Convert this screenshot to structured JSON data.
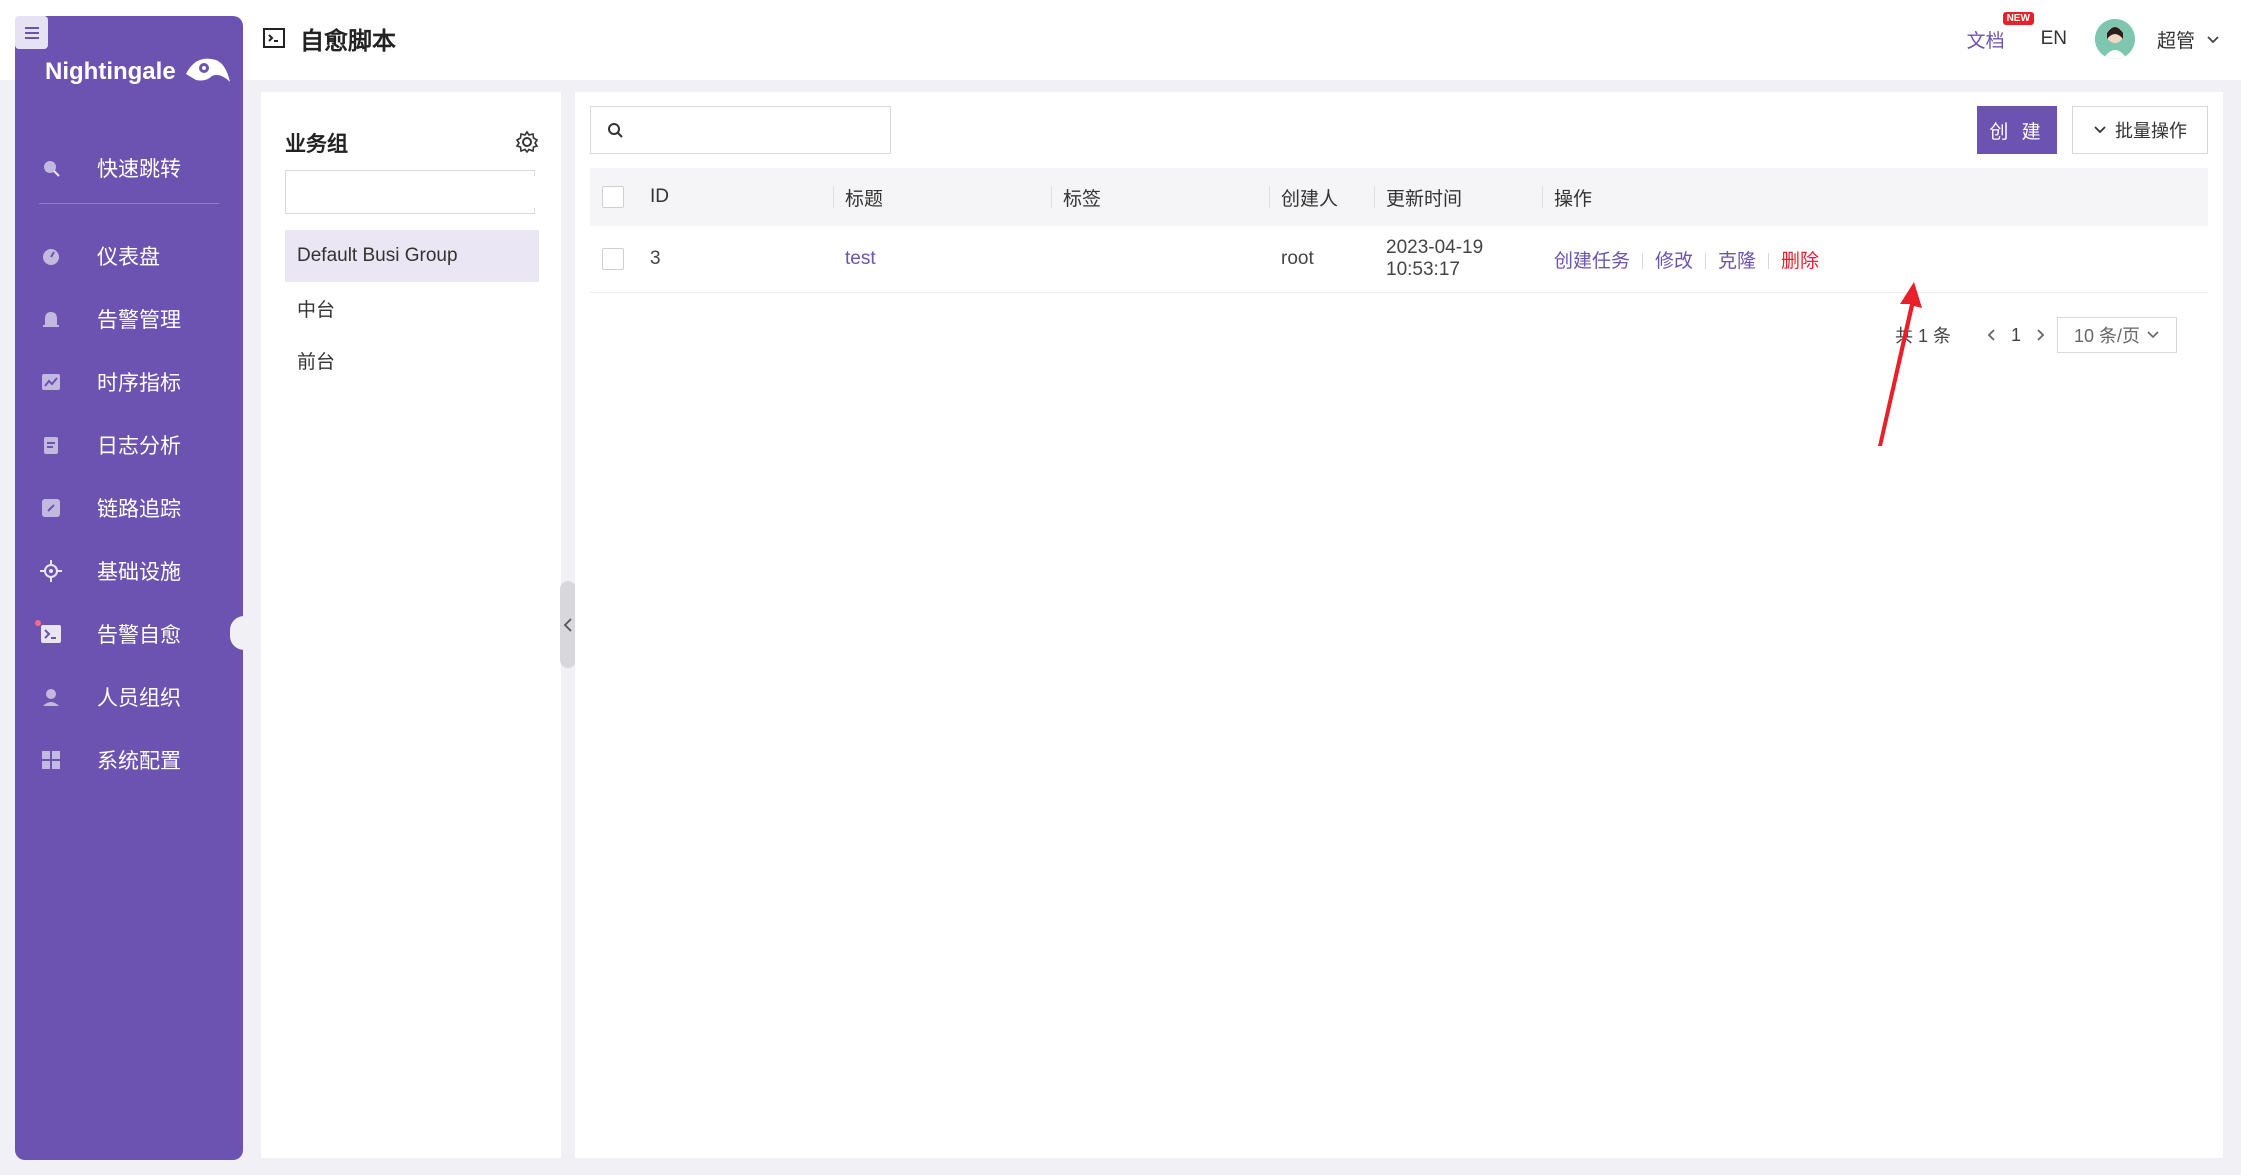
{
  "app": {
    "title": "自愈脚本",
    "logo_text": "Nightingale"
  },
  "header": {
    "docs_label": "文档",
    "docs_badge": "NEW",
    "lang_label": "EN",
    "user_name": "超管"
  },
  "sidebar": {
    "items": [
      {
        "label": "快速跳转",
        "icon": "search-icon"
      },
      {
        "label": "仪表盘",
        "icon": "dashboard-icon"
      },
      {
        "label": "告警管理",
        "icon": "alarm-icon"
      },
      {
        "label": "时序指标",
        "icon": "chart-line-icon"
      },
      {
        "label": "日志分析",
        "icon": "log-icon"
      },
      {
        "label": "链路追踪",
        "icon": "link-icon"
      },
      {
        "label": "基础设施",
        "icon": "target-icon"
      },
      {
        "label": "告警自愈",
        "icon": "terminal-icon"
      },
      {
        "label": "人员组织",
        "icon": "user-icon"
      },
      {
        "label": "系统配置",
        "icon": "grid-icon"
      }
    ],
    "active": "告警自愈"
  },
  "busi_groups": {
    "title": "业务组",
    "search_placeholder": "",
    "items": [
      "Default Busi Group",
      "中台",
      "前台"
    ],
    "selected": "Default Busi Group"
  },
  "toolbar": {
    "search_placeholder": "",
    "create_label": "创 建",
    "batch_label": "批量操作"
  },
  "table": {
    "columns": [
      "ID",
      "标题",
      "标签",
      "创建人",
      "更新时间",
      "操作"
    ],
    "rows": [
      {
        "id": "3",
        "title": "test",
        "tags": "",
        "creator": "root",
        "updated": "2023-04-19 10:53:17",
        "actions": {
          "create_task": "创建任务",
          "edit": "修改",
          "clone": "克隆",
          "delete": "删除"
        }
      }
    ]
  },
  "pagination": {
    "total": "共 1 条",
    "current": "1",
    "page_size": "10 条/页"
  },
  "colors": {
    "brand": "#6c53b1",
    "danger": "#e8202a",
    "page_bg": "#f0f0f5"
  }
}
